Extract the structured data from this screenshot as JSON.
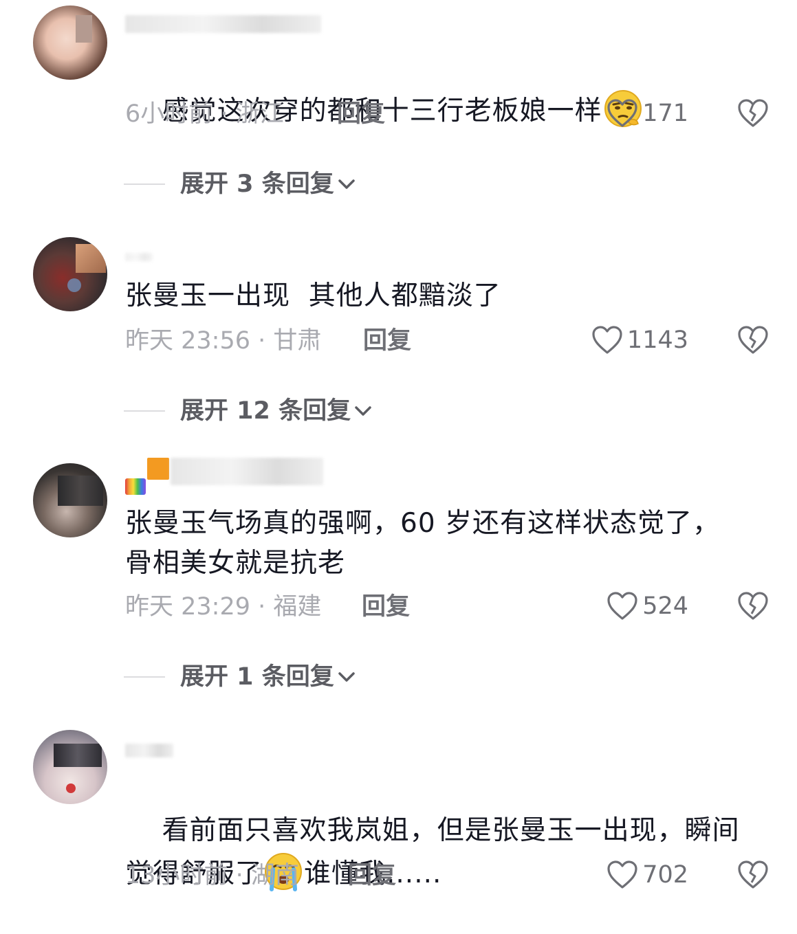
{
  "comments": [
    {
      "text": "感觉这次穿的都和十三行老板娘一样",
      "emoji_after_text": "thinking-face-emoji",
      "meta": "6小时前 · 浙江",
      "reply_label": "回复",
      "likes": "171",
      "expand_label": "展开 3 条回复"
    },
    {
      "text": "张曼玉一出现  其他人都黯淡了",
      "meta": "昨天 23:56 · 甘肃",
      "reply_label": "回复",
      "likes": "1143",
      "expand_label": "展开 12 条回复"
    },
    {
      "text": "张曼玉气场真的强啊，60 岁还有这样状态觉了，骨相美女就是抗老",
      "meta": "昨天 23:29 · 福建",
      "reply_label": "回复",
      "likes": "524",
      "expand_label": "展开 1 条回复"
    },
    {
      "text_part1": "看前面只喜欢我岚姐，但是张曼玉一出现，瞬间觉得舒服了",
      "emoji_mid": "loudly-crying-face-emoji",
      "text_part2": "谁懂我......",
      "meta": "13小时前 · 湖南",
      "reply_label": "回复",
      "likes": "702"
    }
  ],
  "colors": {
    "text": "#161823",
    "meta": "#a9aab0",
    "action": "#6e6f75",
    "expand": "#5b5c62"
  }
}
